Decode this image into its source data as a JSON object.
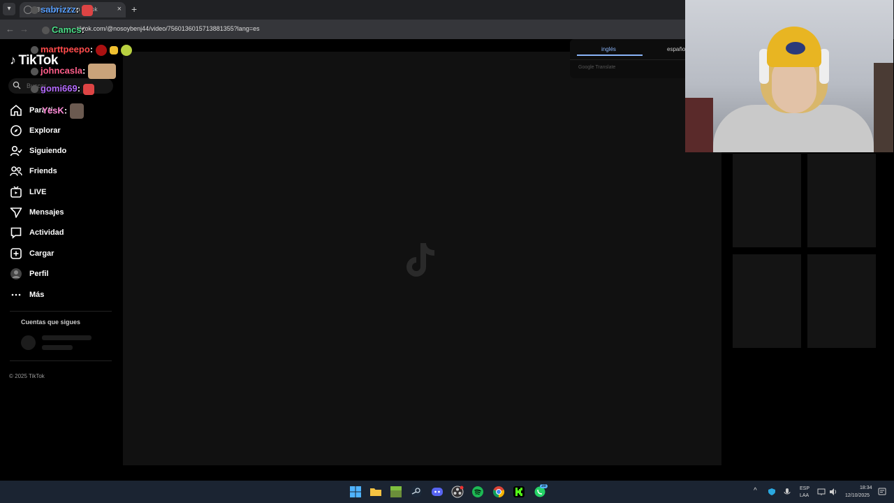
{
  "browser": {
    "tab_title": "@nosoybenj44 en TikTok",
    "tab_close": "×",
    "new_tab": "+",
    "url": "tiktok.com/@nosoybenj44/video/7560136015713881355?lang=es"
  },
  "sidebar": {
    "logo": "TikTok",
    "search_placeholder": "Buscar",
    "items": [
      {
        "label": "Para ti",
        "icon": "home-icon"
      },
      {
        "label": "Explorar",
        "icon": "compass-icon"
      },
      {
        "label": "Siguiendo",
        "icon": "following-icon"
      },
      {
        "label": "Friends",
        "icon": "friends-icon"
      },
      {
        "label": "LIVE",
        "icon": "live-icon"
      },
      {
        "label": "Mensajes",
        "icon": "messages-icon"
      },
      {
        "label": "Actividad",
        "icon": "activity-icon"
      },
      {
        "label": "Cargar",
        "icon": "upload-icon"
      },
      {
        "label": "Perfil",
        "icon": "profile-avatar"
      },
      {
        "label": "Más",
        "icon": "more-icon"
      }
    ],
    "following_title": "Cuentas que sigues",
    "copyright": "© 2025 TikTok"
  },
  "translate": {
    "tab_source": "inglés",
    "tab_target": "español",
    "brand": "Google Translate"
  },
  "chat": [
    {
      "user": "sabrizzz",
      "text": ":",
      "color": "#5aa0ff"
    },
    {
      "user": "Camcs",
      "text": ":",
      "color": "#4de08a"
    },
    {
      "user": "marttpeepo",
      "text": ":",
      "color": "#ff4b4b"
    },
    {
      "user": "johncasla",
      "text": ":",
      "color": "#ff5e8a"
    },
    {
      "user": "gomi669",
      "text": ":",
      "color": "#b56bff"
    },
    {
      "user": "YesK",
      "text": ":",
      "color": "#ff8ad8"
    }
  ],
  "taskbar": {
    "lang_top": "ESP",
    "lang_bottom": "LAA",
    "time": "18:34",
    "date": "12/10/2025",
    "whatsapp_badge": "38",
    "icons": [
      "windows-start-icon",
      "file-explorer-icon",
      "minecraft-icon",
      "steam-icon",
      "discord-icon",
      "obs-icon",
      "spotify-icon",
      "chrome-icon",
      "kick-icon",
      "whatsapp-icon"
    ]
  }
}
